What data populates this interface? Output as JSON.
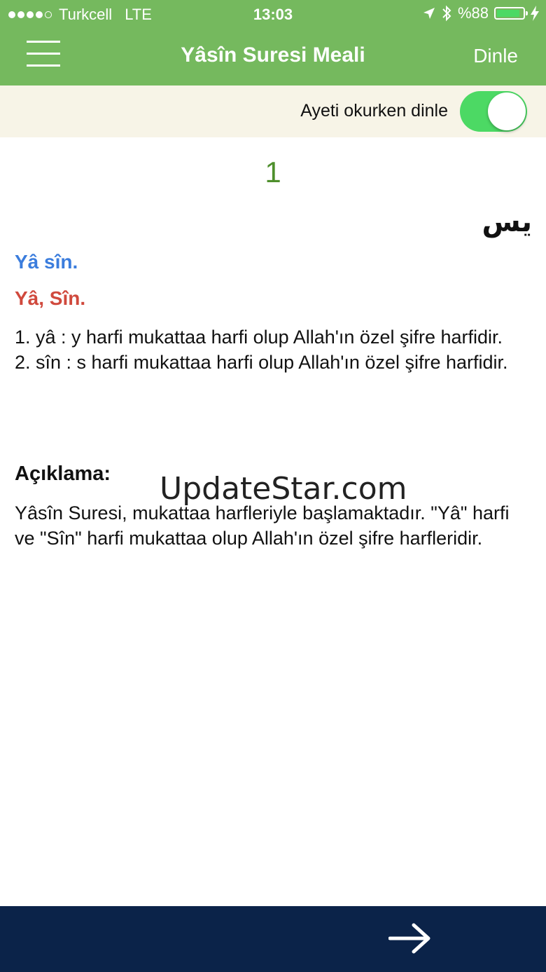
{
  "status_bar": {
    "carrier": "Turkcell",
    "network": "LTE",
    "time": "13:03",
    "battery_percent": "%88",
    "battery_level": 0.88
  },
  "nav": {
    "title": "Yâsîn Suresi Meali",
    "action_label": "Dinle"
  },
  "toggle": {
    "label": "Ayeti okurken dinle",
    "enabled": true
  },
  "verse": {
    "number": "1",
    "arabic": "يس",
    "transliteration": "Yâ sîn.",
    "translation": "Yâ, Sîn.",
    "word_notes": [
      "1. yâ  : y harfi mukattaa harfi olup Allah'ın özel şifre harfidir.",
      "2. sîn : s harfi mukattaa harfi olup Allah'ın özel şifre harfidir."
    ],
    "explanation_title": "Açıklama:",
    "explanation_text": "Yâsîn Suresi, mukattaa harfleriyle başlamaktadır. \"Yâ\" harfi ve \"Sîn\" harfi mukattaa olup Allah'ın özel şifre harfleridir."
  },
  "watermark": "UpdateStar.com",
  "colors": {
    "header": "#75b95e",
    "toggle_bar": "#f7f4e7",
    "switch_on": "#4cd964",
    "verse_number": "#4e8f2c",
    "transliteration": "#3b7ddd",
    "translation": "#d0493d",
    "bottom_bar": "#0b2349"
  },
  "icons": {
    "menu": "hamburger-menu-icon",
    "next": "arrow-right-icon",
    "location": "location-arrow-icon",
    "bluetooth": "bluetooth-icon",
    "battery": "battery-icon",
    "charging": "charging-bolt-icon"
  }
}
